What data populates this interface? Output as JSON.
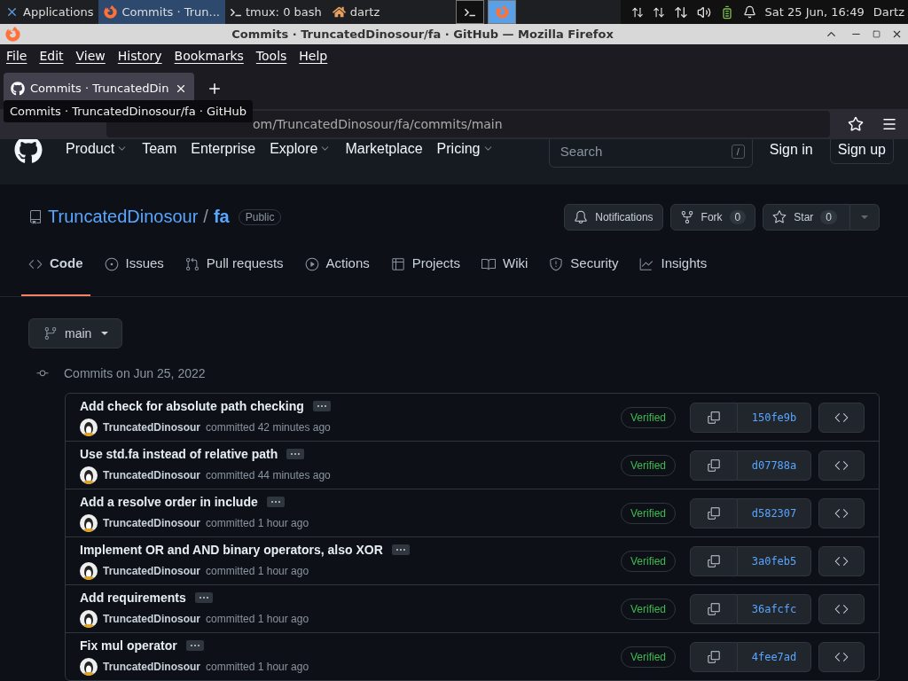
{
  "taskbar": {
    "apps_menu": "Applications",
    "tasks": [
      {
        "kind": "firefox",
        "label": "Commits · Trun...",
        "selected": true
      },
      {
        "kind": "terminal",
        "label": "tmux: 0 bash",
        "selected": false
      },
      {
        "kind": "home",
        "label": "dartz",
        "selected": false
      }
    ],
    "workspaces": [
      {
        "kind": "terminal",
        "selected": false
      },
      {
        "kind": "firefox",
        "selected": true
      }
    ],
    "clock": "Sat 25 Jun, 16:49",
    "user": "Dartz"
  },
  "window": {
    "title": "Commits · TruncatedDinosour/fa · GitHub — Mozilla Firefox"
  },
  "menu": [
    "File",
    "Edit",
    "View",
    "History",
    "Bookmarks",
    "Tools",
    "Help"
  ],
  "browser_tab": {
    "title": "Commits · TruncatedDin"
  },
  "address_bar": {
    "value": "om/TruncatedDinosour/fa/commits/main"
  },
  "tooltip": "Commits · TruncatedDinosour/fa · GitHub",
  "site_nav": {
    "items": [
      {
        "label": "Product",
        "dropdown": true
      },
      {
        "label": "Team",
        "dropdown": false
      },
      {
        "label": "Enterprise",
        "dropdown": false
      },
      {
        "label": "Explore",
        "dropdown": true
      },
      {
        "label": "Marketplace",
        "dropdown": false
      },
      {
        "label": "Pricing",
        "dropdown": true
      }
    ],
    "search": {
      "placeholder": "Search",
      "key": "/"
    },
    "sign_in": "Sign in",
    "sign_up": "Sign up"
  },
  "repo": {
    "owner": "TruncatedDinosour",
    "separator": "/",
    "name": "fa",
    "visibility": "Public",
    "notifications": "Notifications",
    "fork": {
      "label": "Fork",
      "count": "0"
    },
    "star": {
      "label": "Star",
      "count": "0"
    }
  },
  "repo_tabs": [
    {
      "label": "Code",
      "selected": true
    },
    {
      "label": "Issues",
      "selected": false
    },
    {
      "label": "Pull requests",
      "selected": false
    },
    {
      "label": "Actions",
      "selected": false
    },
    {
      "label": "Projects",
      "selected": false
    },
    {
      "label": "Wiki",
      "selected": false
    },
    {
      "label": "Security",
      "selected": false
    },
    {
      "label": "Insights",
      "selected": false
    }
  ],
  "branch": "main",
  "commit_group": {
    "title": "Commits on Jun 25, 2022",
    "commits": [
      {
        "message": "Add check for absolute path checking",
        "author": "TruncatedDinosour",
        "when": "committed 42 minutes ago",
        "badge": "Verified",
        "sha": "150fe9b"
      },
      {
        "message": "Use std.fa instead of relative path",
        "author": "TruncatedDinosour",
        "when": "committed 44 minutes ago",
        "badge": "Verified",
        "sha": "d07788a"
      },
      {
        "message": "Add a resolve order in include",
        "author": "TruncatedDinosour",
        "when": "committed 1 hour ago",
        "badge": "Verified",
        "sha": "d582307"
      },
      {
        "message": "Implement OR and AND binary operators, also XOR",
        "author": "TruncatedDinosour",
        "when": "committed 1 hour ago",
        "badge": "Verified",
        "sha": "3a0feb5"
      },
      {
        "message": "Add requirements",
        "author": "TruncatedDinosour",
        "when": "committed 1 hour ago",
        "badge": "Verified",
        "sha": "36afcfc"
      },
      {
        "message": "Fix mul operator",
        "author": "TruncatedDinosour",
        "when": "committed 1 hour ago",
        "badge": "Verified",
        "sha": "4fee7ad"
      }
    ]
  }
}
